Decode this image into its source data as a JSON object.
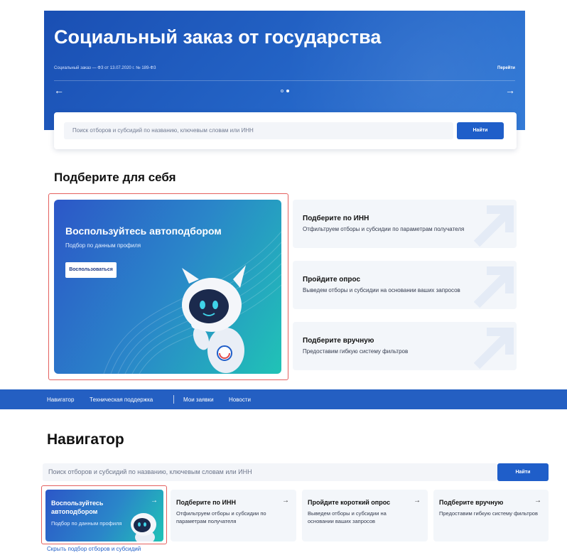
{
  "hero": {
    "title": "Социальный заказ от государства",
    "subtitle": "Социальный заказ — ФЗ от 13.07.2020 г. № 189-ФЗ",
    "link": "Перейти",
    "prev_icon": "arrow-left-icon",
    "next_icon": "arrow-right-icon",
    "slides_total": 2,
    "slide_active": 2
  },
  "search_top": {
    "placeholder": "Поиск отборов и субсидий по названию, ключевым словам или ИНН",
    "button": "Найти"
  },
  "section_title": "Подберите для себя",
  "auto_card": {
    "title": "Воспользуйтесь автоподбором",
    "subtitle": "Подбор по данным профиля",
    "button": "Воспользоваться"
  },
  "options": [
    {
      "title": "Подберите по ИНН",
      "subtitle": "Отфильтруем отборы и субсидии по параметрам получателя"
    },
    {
      "title": "Пройдите опрос",
      "subtitle": "Выведем отборы и субсидии на основании ваших запросов"
    },
    {
      "title": "Подберите вручную",
      "subtitle": "Предоставим гибкую систему фильтров"
    }
  ],
  "navbar": {
    "items": [
      "Навигатор",
      "Техническая поддержка",
      "Мои заявки",
      "Новости"
    ]
  },
  "navigator": {
    "title": "Навигатор",
    "search_placeholder": "Поиск отборов и субсидий по названию, ключевым словам или ИНН",
    "search_button": "Найти",
    "auto": {
      "title": "Воспользуйтесь автоподбором",
      "subtitle": "Подбор по данным профиля",
      "arrow": "→"
    },
    "cards": [
      {
        "title": "Подберите по ИНН",
        "subtitle": "Отфильтруем отборы и субсидии по параметрам получателя",
        "arrow": "→"
      },
      {
        "title": "Пройдите короткий опрос",
        "subtitle": "Выведем отборы и субсидии на основании ваших запросов",
        "arrow": "→"
      },
      {
        "title": "Подберите вручную",
        "subtitle": "Предоставим гибкую систему фильтров",
        "arrow": "→"
      }
    ],
    "hide_link": "Скрыть подбор отборов и субсидий"
  },
  "colors": {
    "primary": "#1f5ec9",
    "hero_bg": "#1a4fb3",
    "highlight_border": "#e4605e",
    "card_bg": "#f3f6fa",
    "gradient_end": "#20c3b6"
  }
}
